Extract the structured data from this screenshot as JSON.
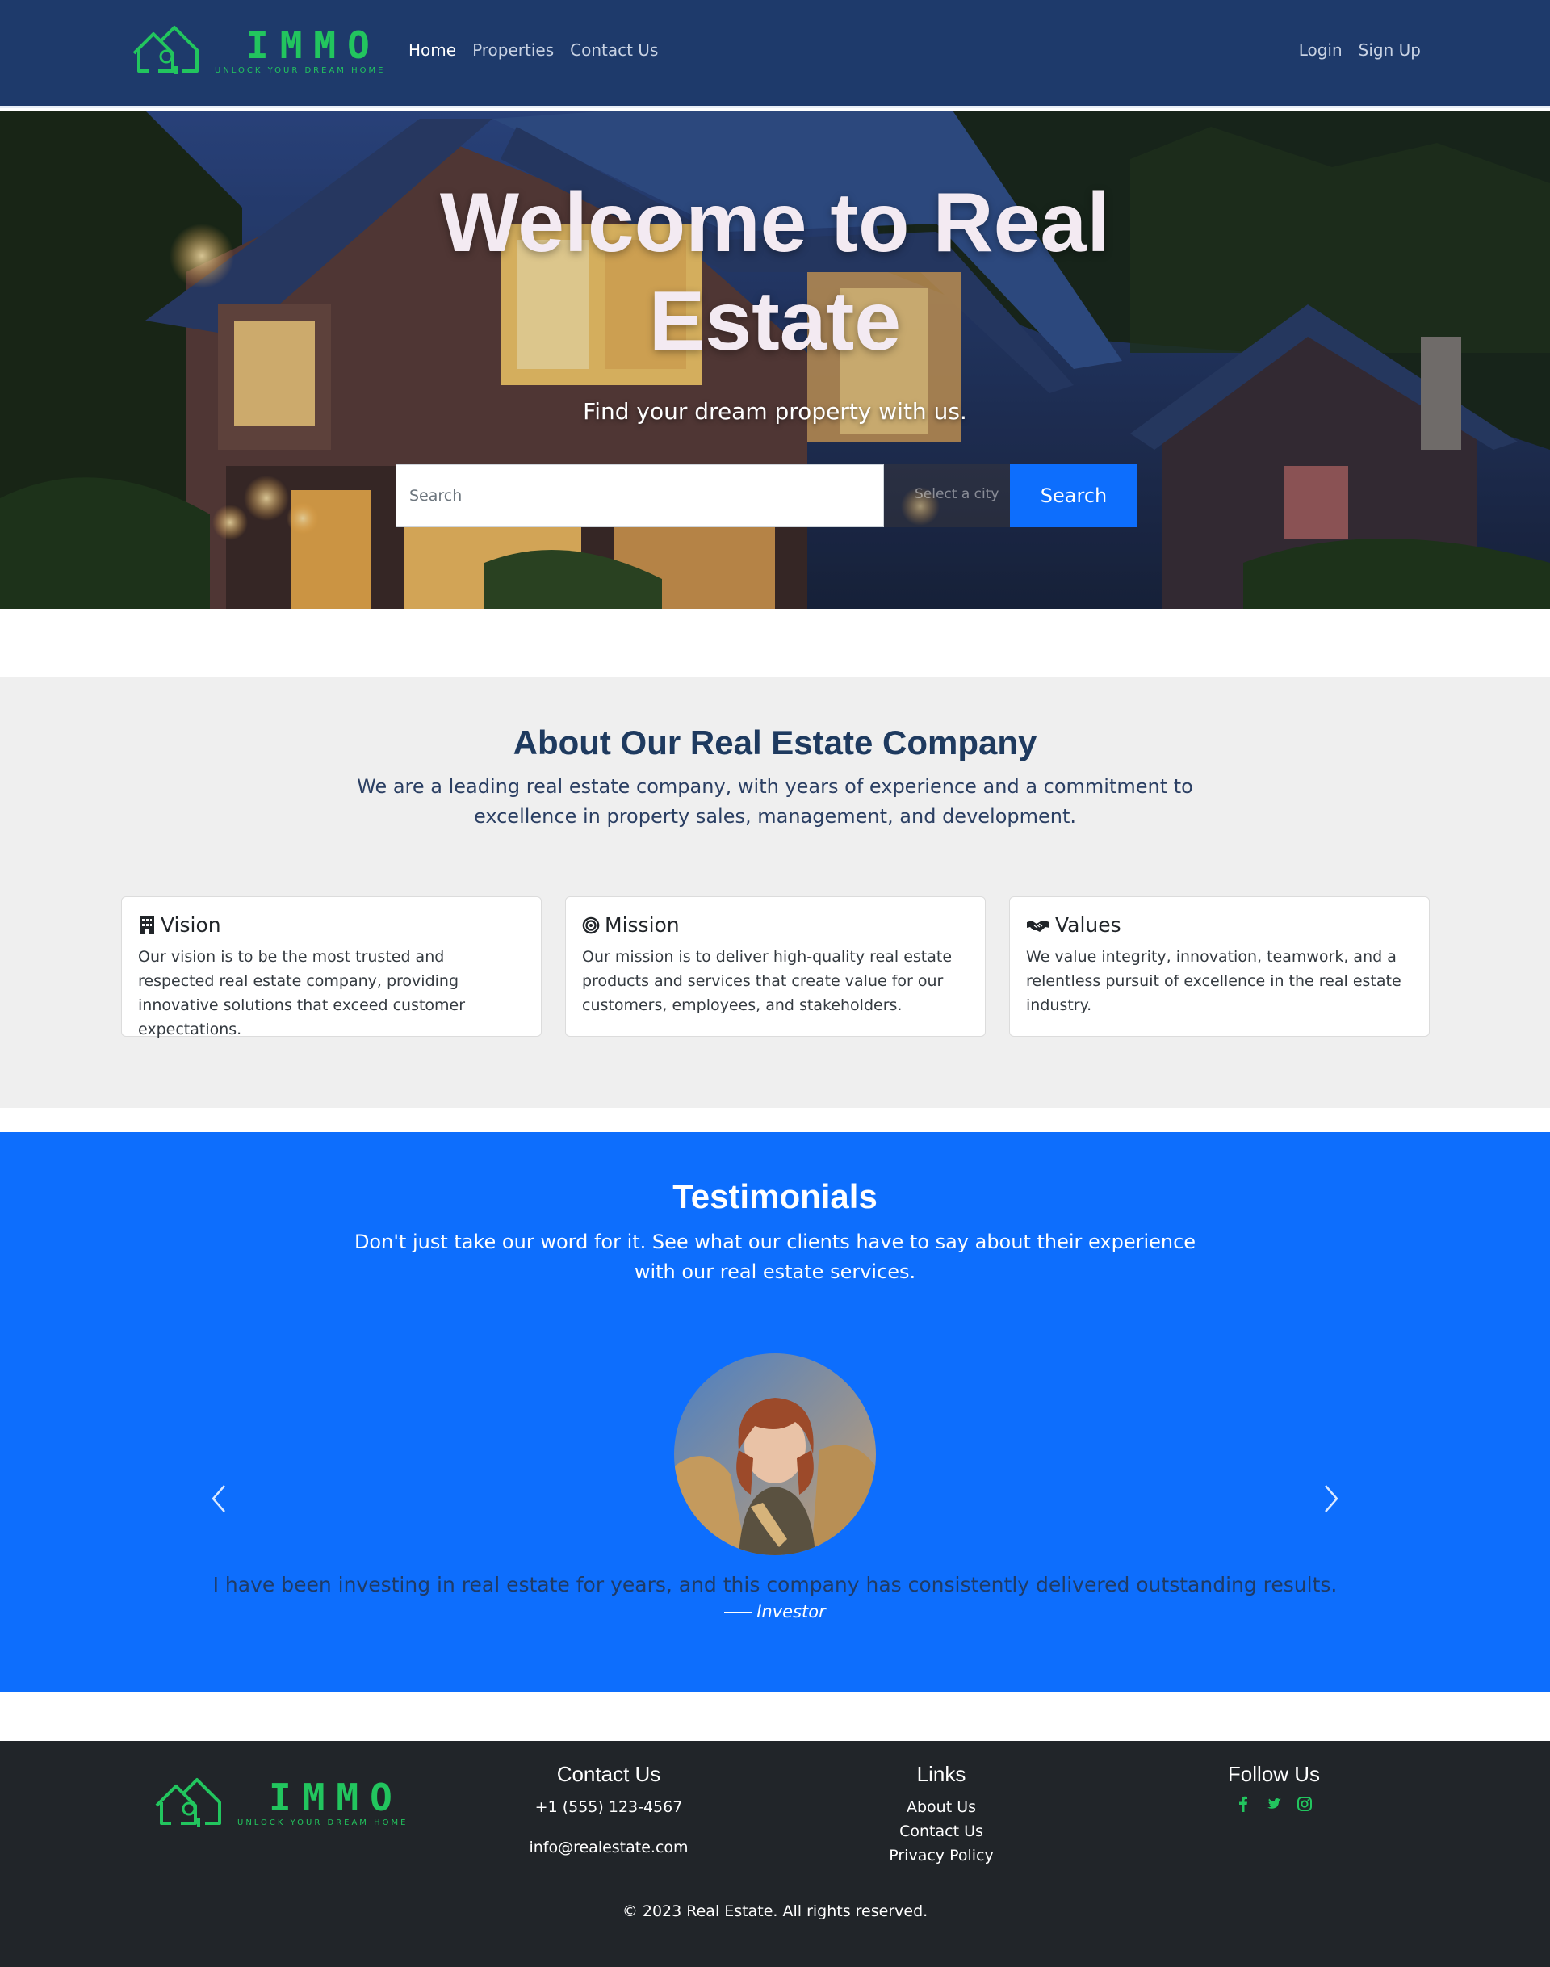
{
  "brand": {
    "name": "IMMO",
    "tagline": "UNLOCK YOUR DREAM HOME",
    "color": "#22c55e"
  },
  "nav": {
    "links": [
      {
        "label": "Home",
        "active": true
      },
      {
        "label": "Properties",
        "active": false
      },
      {
        "label": "Contact Us",
        "active": false
      }
    ],
    "login": "Login",
    "signup": "Sign Up"
  },
  "hero": {
    "title": "Welcome to Real Estate",
    "subtitle": "Find your dream property with us.",
    "search_placeholder": "Search",
    "city_placeholder": "Select a city",
    "search_button": "Search"
  },
  "about": {
    "title": "About Our Real Estate Company",
    "text": "We are a leading real estate company, with years of experience and a commitment to excellence in property sales, management, and development.",
    "cards": [
      {
        "icon": "building-icon",
        "title": "Vision",
        "text": "Our vision is to be the most trusted and respected real estate company, providing innovative solutions that exceed customer expectations."
      },
      {
        "icon": "target-icon",
        "title": "Mission",
        "text": "Our mission is to deliver high-quality real estate products and services that create value for our customers, employees, and stakeholders."
      },
      {
        "icon": "handshake-icon",
        "title": "Values",
        "text": "We value integrity, innovation, teamwork, and a relentless pursuit of excellence in the real estate industry."
      }
    ]
  },
  "testimonials": {
    "title": "Testimonials",
    "text": "Don't just take our word for it. See what our clients have to say about their experience with our real estate services.",
    "quote": "I have been investing in real estate for years, and this company has consistently delivered outstanding results.",
    "author": "Investor",
    "accent": "#0d6efd"
  },
  "footer": {
    "contact_title": "Contact Us",
    "phone": "+1 (555) 123-4567",
    "email": "info@realestate.com",
    "links_title": "Links",
    "links": [
      "About Us",
      "Contact Us",
      "Privacy Policy"
    ],
    "follow_title": "Follow Us",
    "social": [
      "facebook-icon",
      "twitter-icon",
      "instagram-icon"
    ],
    "copyright": "© 2023 Real Estate. All rights reserved."
  }
}
